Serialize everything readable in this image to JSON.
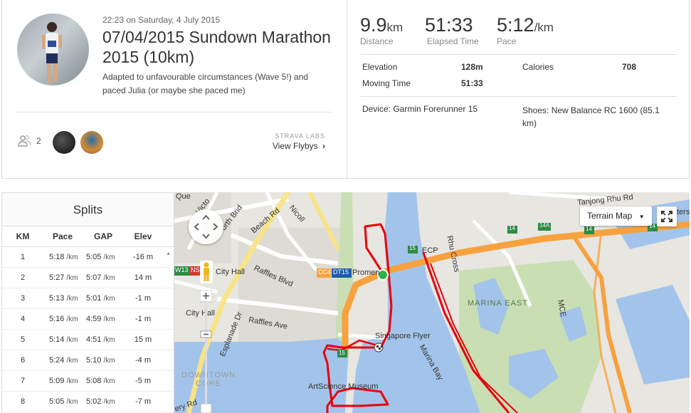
{
  "activity": {
    "datetime": "22:23 on Saturday, 4 July 2015",
    "title": "07/04/2015 Sundown Marathon 2015 (10km)",
    "description": "Adapted to unfavourable circumstances (Wave 5!) and paced Julia (or maybe she paced me)",
    "kudos_count": "2",
    "flyby_label": "STRAVA LABS",
    "flyby_link": "View Flybys"
  },
  "stats": {
    "distance": {
      "value": "9.9",
      "unit": "km",
      "label": "Distance"
    },
    "elapsed": {
      "value": "51:33",
      "label": "Elapsed Time"
    },
    "pace": {
      "value": "5:12",
      "unit": "/km",
      "label": "Pace"
    },
    "elevation_label": "Elevation",
    "elevation_value": "128m",
    "calories_label": "Calories",
    "calories_value": "708",
    "moving_label": "Moving Time",
    "moving_value": "51:33",
    "device": "Device: Garmin Forerunner 15",
    "shoes": "Shoes: New Balance RC 1600 (85.1 km)"
  },
  "splits": {
    "title": "Splits",
    "headers": [
      "KM",
      "Pace",
      "GAP",
      "Elev"
    ],
    "unit": "/km",
    "rows": [
      {
        "km": "1",
        "pace": "5:18",
        "gap": "5:05",
        "elev": "-16 m"
      },
      {
        "km": "2",
        "pace": "5:27",
        "gap": "5:07",
        "elev": "14 m"
      },
      {
        "km": "3",
        "pace": "5:13",
        "gap": "5:01",
        "elev": "-1 m"
      },
      {
        "km": "4",
        "pace": "5:16",
        "gap": "4:59",
        "elev": "-1 m"
      },
      {
        "km": "5",
        "pace": "5:14",
        "gap": "4:51",
        "elev": "15 m"
      },
      {
        "km": "6",
        "pace": "5:24",
        "gap": "5:10",
        "elev": "-4 m"
      },
      {
        "km": "7",
        "pace": "5:09",
        "gap": "5:08",
        "elev": "-5 m"
      },
      {
        "km": "8",
        "pace": "5:05",
        "gap": "5:02",
        "elev": "-7 m"
      }
    ]
  },
  "map": {
    "type_label": "Terrain Map",
    "labels": {
      "city_hall": "City Hall",
      "city_hall2": "City Hall",
      "raffles_blvd": "Raffles Blvd",
      "raffles_ave": "Raffles Ave",
      "esplanade": "Esplanade Dr",
      "promenade": "Promen",
      "flyer": "Singapore Flyer",
      "marina_bay": "Marina Bay",
      "marina_east": "MARINA EAST",
      "downtown": "DOWNTOWN",
      "core": "CORE",
      "museum": "ArtScience Museum",
      "ecp": "ECP",
      "mce": "MCE",
      "tanjong": "Tanjong Rhu Rd",
      "rhu_cross": "Rhu Cross",
      "beach_rd": "Beach Rd",
      "nicoll": "Nicoll",
      "que": "Que",
      "victoria": "Victo",
      "north_bridge": "orth Brid",
      "hwy15": "15",
      "hwy15b": "15",
      "hwy14": "14",
      "hwy14a": "14A",
      "hwy14b": "14",
      "hwy14c": "14",
      "station1": "CC4",
      "station2": "DT15",
      "station3": "W13",
      "station4": "NS",
      "ters": "ters",
      "bay_rd": "ery Rd"
    }
  },
  "colors": {
    "route": "#e8000b",
    "water": "#a3c4ea",
    "park": "#c9dfb3",
    "highway": "#f7a23f",
    "accent": "#fc4c02"
  }
}
